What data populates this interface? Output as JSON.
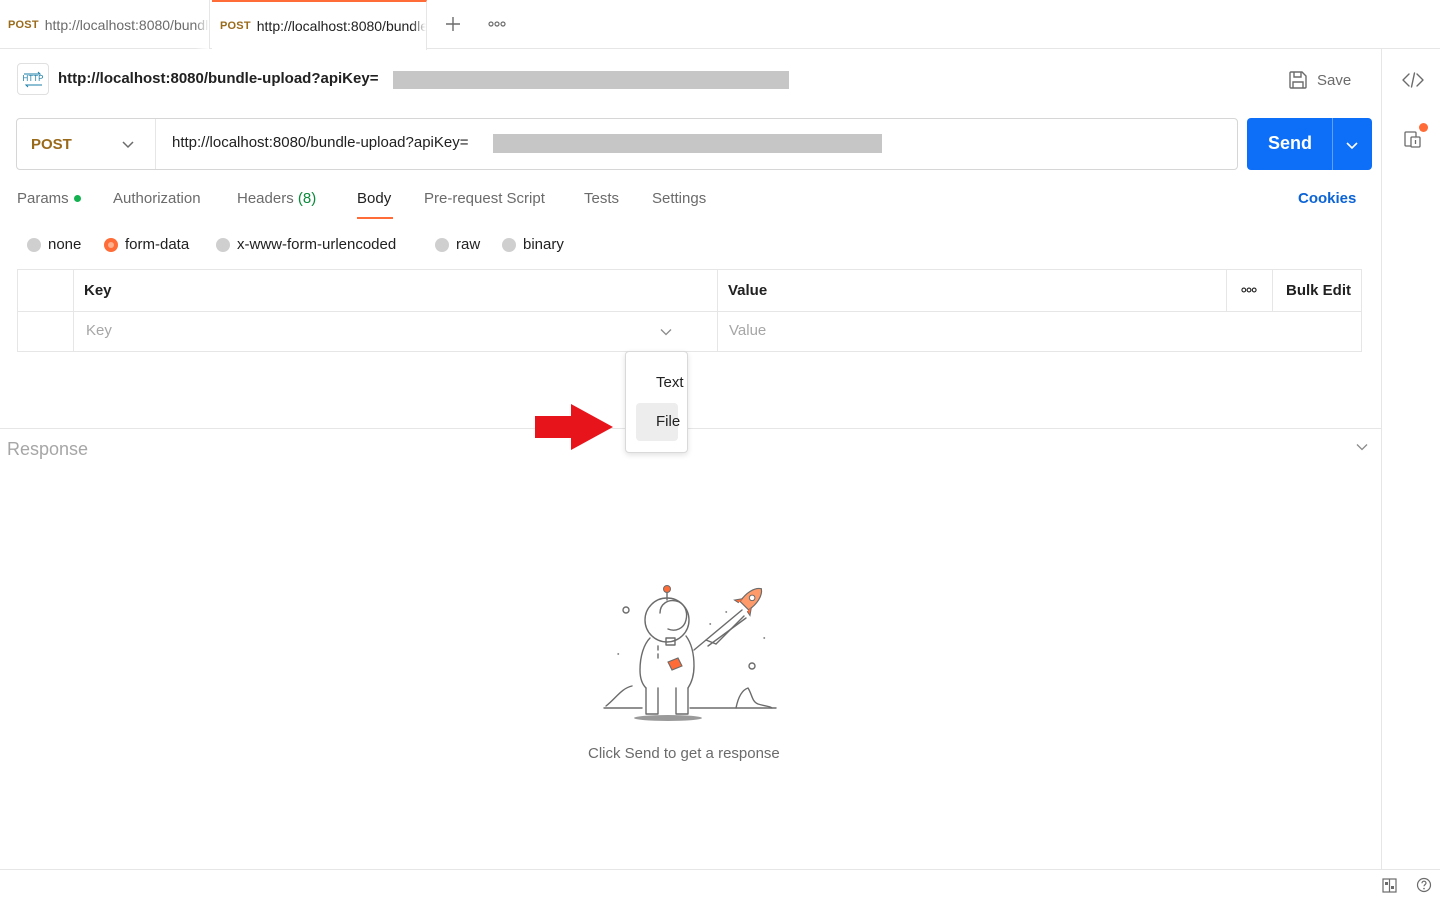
{
  "tabs": [
    {
      "method": "POST",
      "url": "http://localhost:8080/bundle-upload?apiKey=",
      "active": false
    },
    {
      "method": "POST",
      "url": "http://localhost:8080/bundle-upload?apiKey=",
      "active": true
    }
  ],
  "request": {
    "title": "http://localhost:8080/bundle-upload?apiKey=",
    "method": "POST",
    "url": "http://localhost:8080/bundle-upload?apiKey=",
    "save_label": "Save",
    "send_label": "Send"
  },
  "request_tabs": {
    "params": "Params",
    "authorization": "Authorization",
    "headers": "Headers",
    "headers_count": "(8)",
    "body": "Body",
    "prerequest": "Pre-request Script",
    "tests": "Tests",
    "settings": "Settings",
    "cookies": "Cookies",
    "active": "Body"
  },
  "body_types": [
    {
      "label": "none",
      "selected": false
    },
    {
      "label": "form-data",
      "selected": true
    },
    {
      "label": "x-www-form-urlencoded",
      "selected": false
    },
    {
      "label": "raw",
      "selected": false
    },
    {
      "label": "binary",
      "selected": false
    }
  ],
  "kv_table": {
    "key_header": "Key",
    "value_header": "Value",
    "bulk_edit": "Bulk Edit",
    "key_placeholder": "Key",
    "value_placeholder": "Value"
  },
  "type_dropdown": {
    "options": [
      "Text",
      "File"
    ],
    "highlighted": "File"
  },
  "response": {
    "title": "Response",
    "empty_message": "Click Send to get a response"
  },
  "colors": {
    "accent": "#ff6c37",
    "send_button": "#0d6ef7",
    "method_post": "#9a6a1b",
    "cookies_link": "#0b63d6",
    "annotation_arrow": "#e8141c"
  },
  "icons": {
    "new_tab": "plus-icon",
    "tab_options": "more-horizontal-icon",
    "request_type": "http-icon",
    "save": "floppy-disk-icon",
    "code_snippet": "code-icon",
    "documentation": "document-info-icon",
    "footer_layout": "two-pane-layout-icon",
    "footer_help": "help-circle-icon"
  }
}
